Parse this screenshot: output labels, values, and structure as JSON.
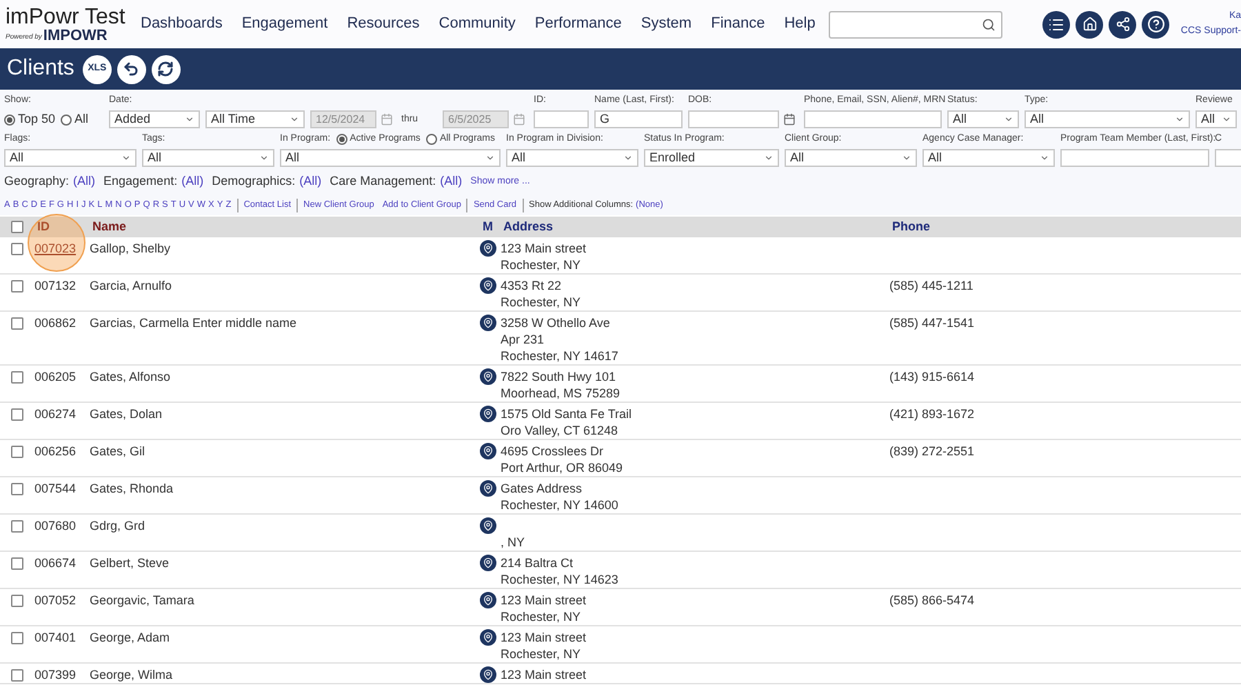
{
  "header": {
    "logo_title": "imPowr Test",
    "logo_powered": "Powered by",
    "logo_brand": "IMPOWR",
    "nav": [
      "Dashboards",
      "Engagement",
      "Resources",
      "Community",
      "Performance",
      "System",
      "Finance",
      "Help"
    ],
    "user_name": "Ka",
    "user_org": "CCS Support-"
  },
  "title_bar": {
    "title": "Clients",
    "xls": "XLS"
  },
  "filter_rows": [
    [
      {
        "kind": "radio_group",
        "label": "Show:",
        "options": [
          {
            "label": "Top 50",
            "selected": true
          },
          {
            "label": "All",
            "selected": false
          }
        ]
      },
      {
        "kind": "select",
        "label": "Date:",
        "value": "Added"
      },
      {
        "kind": "select",
        "value": "All Time"
      },
      {
        "kind": "date",
        "value": "12/5/2024",
        "disabled": true
      },
      {
        "kind": "text",
        "text": "thru"
      },
      {
        "kind": "date",
        "value": "6/5/2025",
        "disabled": true
      },
      {
        "kind": "input",
        "label": "ID:"
      },
      {
        "kind": "input",
        "label": "Name (Last, First):",
        "value": "G"
      },
      {
        "kind": "date",
        "label": "DOB:",
        "disabled": false
      },
      {
        "kind": "input",
        "label": "Phone, Email, SSN, Alien#, MRN"
      },
      {
        "kind": "select",
        "label": "Status:",
        "value": "All"
      },
      {
        "kind": "select",
        "label": "Type:",
        "value": "All"
      },
      {
        "kind": "select",
        "label": "Reviewe",
        "value": "All"
      }
    ],
    [
      {
        "kind": "select",
        "label": "Flags:",
        "value": "All"
      },
      {
        "kind": "select",
        "label": "Tags:",
        "value": "All"
      },
      {
        "kind": "radio_select",
        "label": "In Program:",
        "options": [
          {
            "label": "Active Programs",
            "selected": true
          },
          {
            "label": "All Programs",
            "selected": false
          }
        ],
        "value": "All"
      },
      {
        "kind": "select",
        "label": "In Program in Division:",
        "value": "All"
      },
      {
        "kind": "select",
        "label": "Status In Program:",
        "value": "Enrolled"
      },
      {
        "kind": "select",
        "label": "Client Group:",
        "value": "All"
      },
      {
        "kind": "select",
        "label": "Agency Case Manager:",
        "value": "All"
      },
      {
        "kind": "input",
        "label": "Program Team Member (Last, First):"
      },
      {
        "kind": "input",
        "label": "C"
      }
    ]
  ],
  "summary": {
    "items": [
      {
        "label": "Geography:",
        "value": "(All)"
      },
      {
        "label": "Engagement:",
        "value": "(All)"
      },
      {
        "label": "Demographics:",
        "value": "(All)"
      },
      {
        "label": "Care Management:",
        "value": "(All)"
      }
    ],
    "show_more": "Show more ..."
  },
  "actions": {
    "letters": [
      "A",
      "B",
      "C",
      "D",
      "E",
      "F",
      "G",
      "H",
      "I",
      "J",
      "K",
      "L",
      "M",
      "N",
      "O",
      "P",
      "Q",
      "R",
      "S",
      "T",
      "U",
      "V",
      "W",
      "X",
      "Y",
      "Z"
    ],
    "links": [
      [
        "Contact List"
      ],
      [
        "New Client Group",
        "Add to Client Group"
      ],
      [
        "Send Card"
      ]
    ],
    "additional_label": "Show Additional Columns:",
    "additional_value": "(None)"
  },
  "table": {
    "select_all_checked": false,
    "columns": [
      "ID",
      "Name",
      "M",
      "Address",
      "Phone"
    ],
    "rows": [
      {
        "checked": false,
        "highlighted": true,
        "id": "007023",
        "name": "Gallop, Shelby",
        "address": [
          "123 Main street",
          "Rochester, NY"
        ]
      },
      {
        "checked": false,
        "highlighted": false,
        "id": "007132",
        "name": "Garcia, Arnulfo",
        "address": [
          "4353 Rt 22",
          "Rochester, NY"
        ],
        "phone": "(585) 445-1211"
      },
      {
        "checked": false,
        "highlighted": false,
        "id": "006862",
        "name": "Garcias, Carmella Enter middle name",
        "address": [
          "3258 W Othello Ave",
          "Apr 231",
          "Rochester, NY 14617"
        ],
        "phone": "(585) 447-1541"
      },
      {
        "checked": false,
        "highlighted": false,
        "id": "006205",
        "name": "Gates, Alfonso",
        "address": [
          "7822 South Hwy 101",
          "Moorhead, MS 75289"
        ],
        "phone": "(143) 915-6614"
      },
      {
        "checked": false,
        "highlighted": false,
        "id": "006274",
        "name": "Gates, Dolan",
        "address": [
          "1575 Old Santa Fe Trail",
          "Oro Valley, CT 61248"
        ],
        "phone": "(421) 893-1672"
      },
      {
        "checked": false,
        "highlighted": false,
        "id": "006256",
        "name": "Gates, Gil",
        "address": [
          "4695 Crosslees Dr",
          "Port Arthur, OR 86049"
        ],
        "phone": "(839) 272-2551"
      },
      {
        "checked": false,
        "highlighted": false,
        "id": "007544",
        "name": "Gates, Rhonda",
        "address": [
          "Gates Address",
          "Rochester, NY 14600"
        ]
      },
      {
        "checked": false,
        "highlighted": false,
        "id": "007680",
        "name": "Gdrg, Grd",
        "blank_street": true,
        "address": [
          ", NY"
        ]
      },
      {
        "checked": false,
        "highlighted": false,
        "id": "006674",
        "name": "Gelbert, Steve",
        "address": [
          "214 Baltra Ct",
          "Rochester, NY 14623"
        ]
      },
      {
        "checked": false,
        "highlighted": false,
        "id": "007052",
        "name": "Georgavic, Tamara",
        "address": [
          "123 Main street",
          "Rochester, NY"
        ],
        "phone": "(585) 866-5474"
      },
      {
        "checked": false,
        "highlighted": false,
        "id": "007401",
        "name": "George, Adam",
        "address": [
          "123 Main street",
          "Rochester, NY"
        ]
      },
      {
        "checked": false,
        "highlighted": false,
        "id": "007399",
        "name": "George, Wilma",
        "address": [
          "123 Main street"
        ]
      }
    ]
  }
}
